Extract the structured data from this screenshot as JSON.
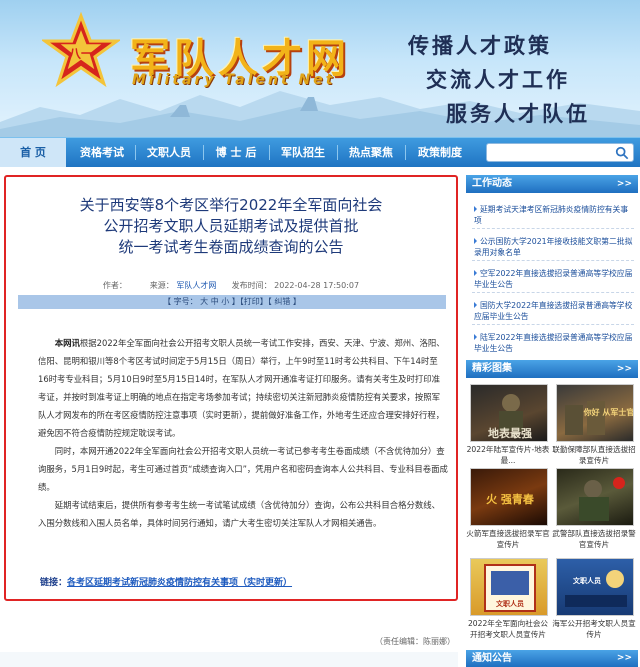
{
  "banner": {
    "logo_cn": "军队人才网",
    "logo_en": "Military Talent Net",
    "slogans": [
      "传播人才政策",
      "交流人才工作",
      "服务人才队伍"
    ]
  },
  "nav": {
    "items": [
      "首 页",
      "资格考试",
      "文职人员",
      "博 士 后",
      "军队招生",
      "热点聚焦",
      "政策制度"
    ],
    "active_index": 0,
    "search_placeholder": ""
  },
  "article": {
    "title_lines": [
      "关于西安等8个考区举行2022年全军面向社会",
      "公开招考文职人员延期考试及提供首批",
      "统一考试考生卷面成绩查询的公告"
    ],
    "meta": {
      "author_label": "作者：",
      "source_label": "来源：",
      "source": "军队人才网",
      "time_label": "发布时间：",
      "time": "2022-04-28 17:50:07"
    },
    "toolbar": "【 字号： 大 中 小 】【打印】【 纠错 】",
    "lead": "本网讯",
    "paragraphs": [
      "根据2022年全军面向社会公开招考文职人员统一考试工作安排，西安、天津、宁波、郑州、洛阳、信阳、昆明和银川等8个考区考试时间定于5月15日（周日）举行，上午9时至11时考公共科目、下午14时至16时考专业科目；5月10日9时至5月15日14时，在军队人才网开通准考证打印服务。请有关考生及时打印准考证，并按时到准考证上明确的地点在指定考场参加考试；持续密切关注新冠肺炎疫情防控有关要求，按照军队人才网发布的所在考区疫情防控注意事项（实时更新），提前做好准备工作，外地考生还应合理安排好行程，避免因不符合疫情防控规定耽误考试。",
      "同时，本网开通2022年全军面向社会公开招考文职人员统一考试已参考考生卷面成绩（不含优待加分）查询服务，5月1日9时起，考生可通过首页“成绩查询入口”，凭用户名和密码查询本人公共科目、专业科目卷面成绩。",
      "延期考试结束后，提供所有参考考生统一考试笔试成绩（含优待加分）查询，公布公共科目合格分数线、入围分数线和入围人员名单，具体时间另行通知，请广大考生密切关注军队人才网相关通告。"
    ],
    "link_label": "链接：",
    "link_text": "各考区延期考试新冠肺炎疫情防控有关事项（实时更新）",
    "editor": "（责任编辑：陈丽娜）"
  },
  "sidebar": {
    "news_title": "工作动态",
    "more": ">>",
    "news": [
      "延期考试天津考区新冠肺炎疫情防控有关事项",
      "公示国防大学2021年接收技能文职第二批拟录用对象名单",
      "空军2022年直接选拔招录普通高等学校应届毕业生公告",
      "国防大学2022年直接选拔招录普通高等学校应届毕业生公告",
      "陆军2022年直接选拔招录普通高等学校应届毕业生公告"
    ],
    "gallery_title": "精彩图集",
    "gallery": [
      {
        "caption": "2022年陆军宣传片-地表最...",
        "art": "地表最强"
      },
      {
        "caption": "联勤保障部队直接选拔招录宣传片",
        "art": "你好 从军士官"
      },
      {
        "caption": "火箭军直接选拔招录军官宣传片",
        "art": "火 强青春"
      },
      {
        "caption": "武警部队直接选拔招录警官宣传片",
        "art": ""
      },
      {
        "caption": "2022年全军面向社会公开招考文职人员宣传片",
        "art": "文职人员"
      },
      {
        "caption": "海军公开招考文职人员宣传片",
        "art": "文职人员"
      }
    ],
    "notice_title": "通知公告"
  },
  "colors": {
    "nav_blue": "#1f74c2",
    "article_border": "#e02424",
    "title_blue": "#1e3a7a",
    "link_blue": "#1e5bbf"
  }
}
